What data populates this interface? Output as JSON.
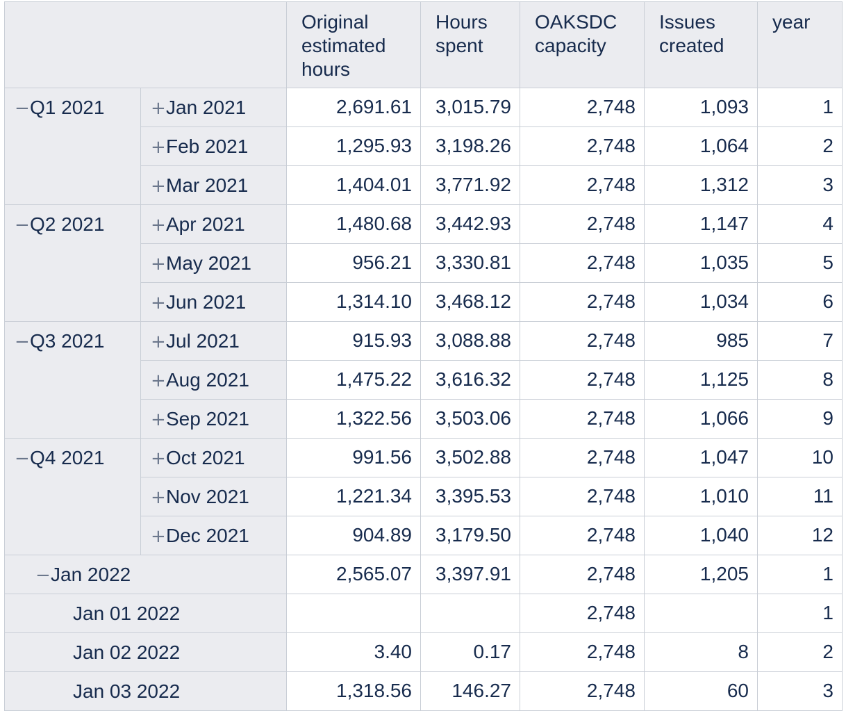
{
  "columns": [
    "Original estimated hours",
    "Hours spent",
    "OAKSDC capacity",
    "Issues created",
    "year"
  ],
  "quarters": [
    {
      "label": "Q1 2021",
      "toggle": "−",
      "months": [
        {
          "label": "Jan 2021",
          "toggle": "+",
          "values": [
            "2,691.61",
            "3,015.79",
            "2,748",
            "1,093",
            "1"
          ]
        },
        {
          "label": "Feb 2021",
          "toggle": "+",
          "values": [
            "1,295.93",
            "3,198.26",
            "2,748",
            "1,064",
            "2"
          ]
        },
        {
          "label": "Mar 2021",
          "toggle": "+",
          "values": [
            "1,404.01",
            "3,771.92",
            "2,748",
            "1,312",
            "3"
          ]
        }
      ]
    },
    {
      "label": "Q2 2021",
      "toggle": "−",
      "months": [
        {
          "label": "Apr 2021",
          "toggle": "+",
          "values": [
            "1,480.68",
            "3,442.93",
            "2,748",
            "1,147",
            "4"
          ]
        },
        {
          "label": "May 2021",
          "toggle": "+",
          "values": [
            "956.21",
            "3,330.81",
            "2,748",
            "1,035",
            "5"
          ]
        },
        {
          "label": "Jun 2021",
          "toggle": "+",
          "values": [
            "1,314.10",
            "3,468.12",
            "2,748",
            "1,034",
            "6"
          ]
        }
      ]
    },
    {
      "label": "Q3 2021",
      "toggle": "−",
      "months": [
        {
          "label": "Jul 2021",
          "toggle": "+",
          "values": [
            "915.93",
            "3,088.88",
            "2,748",
            "985",
            "7"
          ]
        },
        {
          "label": "Aug 2021",
          "toggle": "+",
          "values": [
            "1,475.22",
            "3,616.32",
            "2,748",
            "1,125",
            "8"
          ]
        },
        {
          "label": "Sep 2021",
          "toggle": "+",
          "values": [
            "1,322.56",
            "3,503.06",
            "2,748",
            "1,066",
            "9"
          ]
        }
      ]
    },
    {
      "label": "Q4 2021",
      "toggle": "−",
      "months": [
        {
          "label": "Oct 2021",
          "toggle": "+",
          "values": [
            "991.56",
            "3,502.88",
            "2,748",
            "1,047",
            "10"
          ]
        },
        {
          "label": "Nov 2021",
          "toggle": "+",
          "values": [
            "1,221.34",
            "3,395.53",
            "2,748",
            "1,010",
            "11"
          ]
        },
        {
          "label": "Dec 2021",
          "toggle": "+",
          "values": [
            "904.89",
            "3,179.50",
            "2,748",
            "1,040",
            "12"
          ]
        }
      ]
    }
  ],
  "expanded_month": {
    "label": "Jan 2022",
    "toggle": "−",
    "values": [
      "2,565.07",
      "3,397.91",
      "2,748",
      "1,205",
      "1"
    ]
  },
  "days": [
    {
      "label": "Jan 01 2022",
      "values": [
        "",
        "",
        "2,748",
        "",
        "1"
      ]
    },
    {
      "label": "Jan 02 2022",
      "values": [
        "3.40",
        "0.17",
        "2,748",
        "8",
        "2"
      ]
    },
    {
      "label": "Jan 03 2022",
      "values": [
        "1,318.56",
        "146.27",
        "2,748",
        "60",
        "3"
      ]
    }
  ]
}
